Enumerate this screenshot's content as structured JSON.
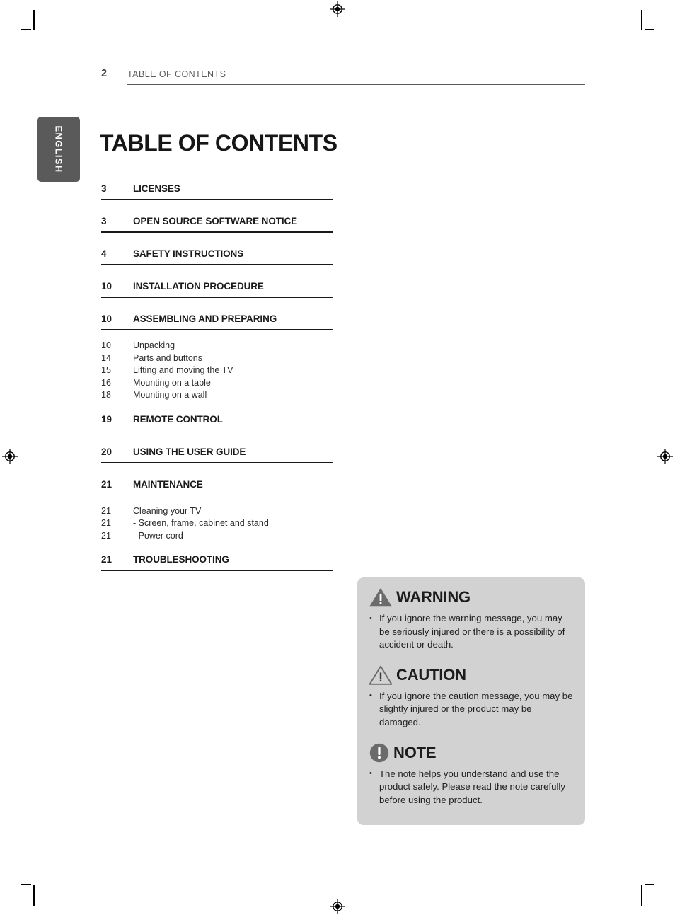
{
  "header": {
    "page_number": "2",
    "section_label": "TABLE OF CONTENTS"
  },
  "language_tab": {
    "label": "ENGLISH"
  },
  "title": "TABLE OF CONTENTS",
  "toc": {
    "entries": [
      {
        "page": "3",
        "label": "LICENSES",
        "subentries": []
      },
      {
        "page": "3",
        "label": "OPEN SOURCE SOFTWARE NOTICE",
        "subentries": []
      },
      {
        "page": "4",
        "label": "SAFETY INSTRUCTIONS",
        "subentries": []
      },
      {
        "page": "10",
        "label": "INSTALLATION PROCEDURE",
        "subentries": []
      },
      {
        "page": "10",
        "label": "ASSEMBLING AND PREPARING",
        "subentries": [
          {
            "page": "10",
            "label": "Unpacking"
          },
          {
            "page": "14",
            "label": "Parts and buttons"
          },
          {
            "page": "15",
            "label": "Lifting and moving the TV"
          },
          {
            "page": "16",
            "label": "Mounting on a table"
          },
          {
            "page": "18",
            "label": "Mounting on a wall"
          }
        ]
      },
      {
        "page": "19",
        "label": "REMOTE CONTROL",
        "subentries": []
      },
      {
        "page": "20",
        "label": "USING THE USER GUIDE",
        "subentries": []
      },
      {
        "page": "21",
        "label": "MAINTENANCE",
        "subentries": [
          {
            "page": "21",
            "label": "Cleaning your TV"
          },
          {
            "page": "21",
            "label": "-  Screen, frame, cabinet and stand"
          },
          {
            "page": "21",
            "label": "-  Power cord"
          }
        ]
      },
      {
        "page": "21",
        "label": "TROUBLESHOOTING",
        "subentries": []
      }
    ]
  },
  "notices": {
    "warning": {
      "icon": "warning-triangle-filled-icon",
      "heading": "WARNING",
      "text": "If you ignore the warning message, you may be seriously injured or there is a possibility of accident or death."
    },
    "caution": {
      "icon": "caution-triangle-outline-icon",
      "heading": "CAUTION",
      "text": "If you ignore the caution message, you may be slightly injured or the product may be damaged."
    },
    "note": {
      "icon": "note-circle-exclamation-icon",
      "heading": "NOTE",
      "text": "The note helps you understand and use the product safely. Please read the note carefully before using the product."
    }
  },
  "colors": {
    "notice_box_bg": "#d2d2d2",
    "lang_tab_bg": "#5a5a5a",
    "icon_gray": "#6b6b6b",
    "text": "#1a1a1a"
  }
}
